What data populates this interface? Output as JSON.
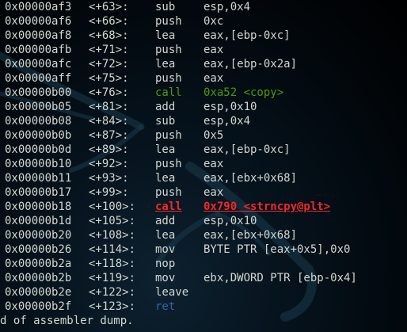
{
  "window": {
    "background": "#000000",
    "text_color": "#d3d7cf",
    "highlight_colors": {
      "call_local": "#4e9a06",
      "ret": "#3465a4",
      "call_plt": "#ef2929"
    },
    "watermark": "kali-dragon-logo"
  },
  "disassembly": {
    "lines": [
      {
        "addr": "0x00000af3",
        "offset": "<+63>:",
        "mnemonic": "sub",
        "operands": "esp,0x4",
        "style": "normal"
      },
      {
        "addr": "0x00000af6",
        "offset": "<+66>:",
        "mnemonic": "push",
        "operands": "0xc",
        "style": "normal"
      },
      {
        "addr": "0x00000af8",
        "offset": "<+68>:",
        "mnemonic": "lea",
        "operands": "eax,[ebp-0xc]",
        "style": "normal"
      },
      {
        "addr": "0x00000afb",
        "offset": "<+71>:",
        "mnemonic": "push",
        "operands": "eax",
        "style": "normal"
      },
      {
        "addr": "0x00000afc",
        "offset": "<+72>:",
        "mnemonic": "lea",
        "operands": "eax,[ebp-0x2a]",
        "style": "normal"
      },
      {
        "addr": "0x00000aff",
        "offset": "<+75>:",
        "mnemonic": "push",
        "operands": "eax",
        "style": "normal"
      },
      {
        "addr": "0x00000b00",
        "offset": "<+76>:",
        "mnemonic": "call",
        "operands": "0xa52 <copy>",
        "style": "green"
      },
      {
        "addr": "0x00000b05",
        "offset": "<+81>:",
        "mnemonic": "add",
        "operands": "esp,0x10",
        "style": "normal"
      },
      {
        "addr": "0x00000b08",
        "offset": "<+84>:",
        "mnemonic": "sub",
        "operands": "esp,0x4",
        "style": "normal"
      },
      {
        "addr": "0x00000b0b",
        "offset": "<+87>:",
        "mnemonic": "push",
        "operands": "0x5",
        "style": "normal"
      },
      {
        "addr": "0x00000b0d",
        "offset": "<+89>:",
        "mnemonic": "lea",
        "operands": "eax,[ebp-0xc]",
        "style": "normal"
      },
      {
        "addr": "0x00000b10",
        "offset": "<+92>:",
        "mnemonic": "push",
        "operands": "eax",
        "style": "normal"
      },
      {
        "addr": "0x00000b11",
        "offset": "<+93>:",
        "mnemonic": "lea",
        "operands": "eax,[ebx+0x68]",
        "style": "normal"
      },
      {
        "addr": "0x00000b17",
        "offset": "<+99>:",
        "mnemonic": "push",
        "operands": "eax",
        "style": "normal"
      },
      {
        "addr": "0x00000b18",
        "offset": "<+100>:",
        "mnemonic": "call",
        "operands": "0x790 <strncpy@plt>",
        "style": "red"
      },
      {
        "addr": "0x00000b1d",
        "offset": "<+105>:",
        "mnemonic": "add",
        "operands": "esp,0x10",
        "style": "normal"
      },
      {
        "addr": "0x00000b20",
        "offset": "<+108>:",
        "mnemonic": "lea",
        "operands": "eax,[ebx+0x68]",
        "style": "normal"
      },
      {
        "addr": "0x00000b26",
        "offset": "<+114>:",
        "mnemonic": "mov",
        "operands": "BYTE PTR [eax+0x5],0x0",
        "style": "normal"
      },
      {
        "addr": "0x00000b2a",
        "offset": "<+118>:",
        "mnemonic": "nop",
        "operands": "",
        "style": "normal"
      },
      {
        "addr": "0x00000b2b",
        "offset": "<+119>:",
        "mnemonic": "mov",
        "operands": "ebx,DWORD PTR [ebp-0x4]",
        "style": "normal"
      },
      {
        "addr": "0x00000b2e",
        "offset": "<+122>:",
        "mnemonic": "leave",
        "operands": "",
        "style": "normal"
      },
      {
        "addr": "0x00000b2f",
        "offset": "<+123>:",
        "mnemonic": "ret",
        "operands": "",
        "style": "blue"
      }
    ],
    "footer": "d of assembler dump."
  }
}
